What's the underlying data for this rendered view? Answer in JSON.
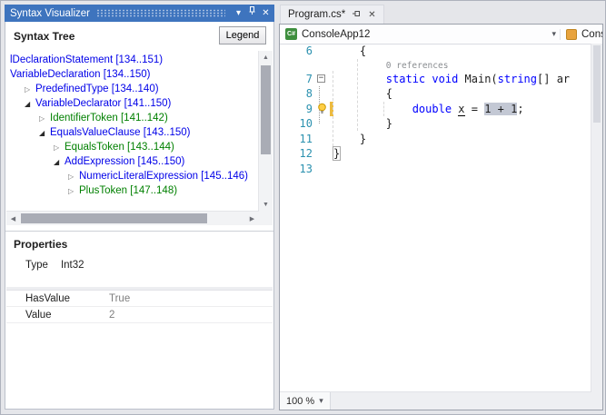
{
  "syntax_visualizer": {
    "title": "Syntax Visualizer",
    "tree_header": "Syntax Tree",
    "legend_button": "Legend",
    "tree": [
      {
        "label": "lDeclarationStatement [134..151)",
        "indent": 0,
        "arrow": "none",
        "kind": "node"
      },
      {
        "label": "VariableDeclaration [134..150)",
        "indent": 0,
        "arrow": "none",
        "kind": "node"
      },
      {
        "label": "PredefinedType [134..140)",
        "indent": 1,
        "arrow": "collapsed",
        "kind": "node"
      },
      {
        "label": "VariableDeclarator [141..150)",
        "indent": 1,
        "arrow": "expanded",
        "kind": "node"
      },
      {
        "label": "IdentifierToken [141..142)",
        "indent": 2,
        "arrow": "collapsed",
        "kind": "token"
      },
      {
        "label": "EqualsValueClause [143..150)",
        "indent": 2,
        "arrow": "expanded",
        "kind": "node"
      },
      {
        "label": "EqualsToken [143..144)",
        "indent": 3,
        "arrow": "collapsed",
        "kind": "token"
      },
      {
        "label": "AddExpression [145..150)",
        "indent": 3,
        "arrow": "expanded",
        "kind": "node"
      },
      {
        "label": "NumericLiteralExpression [145..146)",
        "indent": 4,
        "arrow": "collapsed",
        "kind": "node"
      },
      {
        "label": "PlusToken [147..148)",
        "indent": 4,
        "arrow": "collapsed",
        "kind": "token"
      }
    ],
    "properties": {
      "header": "Properties",
      "type_label": "Type",
      "type_value": "Int32",
      "rows": [
        {
          "name": "HasValue",
          "value": "True"
        },
        {
          "name": "Value",
          "value": "2"
        }
      ]
    }
  },
  "editor": {
    "tab_title": "Program.cs*",
    "nav": {
      "project": "ConsoleApp12",
      "member": "Cons"
    },
    "zoom_level": "100 %",
    "lines": [
      {
        "num": "6",
        "tokens": [
          [
            "    {",
            "plain"
          ]
        ]
      },
      {
        "num": "",
        "codelens": true,
        "tokens": [
          [
            "        ",
            "plain"
          ],
          [
            "0 references",
            "codelens"
          ]
        ]
      },
      {
        "num": "7",
        "fold": true,
        "tokens": [
          [
            "        ",
            "plain"
          ],
          [
            "static",
            "kw"
          ],
          [
            " ",
            "plain"
          ],
          [
            "void",
            "kw"
          ],
          [
            " Main(",
            "plain"
          ],
          [
            "string",
            "kw"
          ],
          [
            "[] ar",
            "plain"
          ]
        ]
      },
      {
        "num": "8",
        "tokens": [
          [
            "        {",
            "plain"
          ]
        ]
      },
      {
        "num": "9",
        "bulb": true,
        "changed": true,
        "tokens": [
          [
            "            ",
            "plain"
          ],
          [
            "double",
            "kw"
          ],
          [
            " ",
            "plain"
          ],
          [
            "x",
            "caret"
          ],
          [
            " = ",
            "plain"
          ],
          [
            "1 + 1",
            "hl"
          ],
          [
            ";",
            "plain"
          ]
        ]
      },
      {
        "num": "10",
        "tokens": [
          [
            "        }",
            "plain"
          ]
        ]
      },
      {
        "num": "11",
        "tokens": [
          [
            "    }",
            "plain"
          ]
        ]
      },
      {
        "num": "12",
        "tokens": [
          [
            "}",
            "boxed"
          ]
        ]
      },
      {
        "num": "13",
        "tokens": []
      }
    ]
  },
  "icons": {
    "chevron_down": "▾",
    "close": "✕",
    "scroll_up": "▲",
    "scroll_down": "▼",
    "scroll_left": "◀",
    "scroll_right": "▶",
    "tree_expanded": "◢",
    "tree_collapsed": "▷",
    "fold_toggle": "−"
  },
  "colors": {
    "titlebar": "#3E74BE",
    "keyword": "#0000FF",
    "node": "#0000E8",
    "token": "#008000",
    "line_number": "#2B91AF",
    "highlight": "#C3C8D4",
    "codelens_text": "#8A8D91",
    "change_bar": "#EDBB40"
  }
}
